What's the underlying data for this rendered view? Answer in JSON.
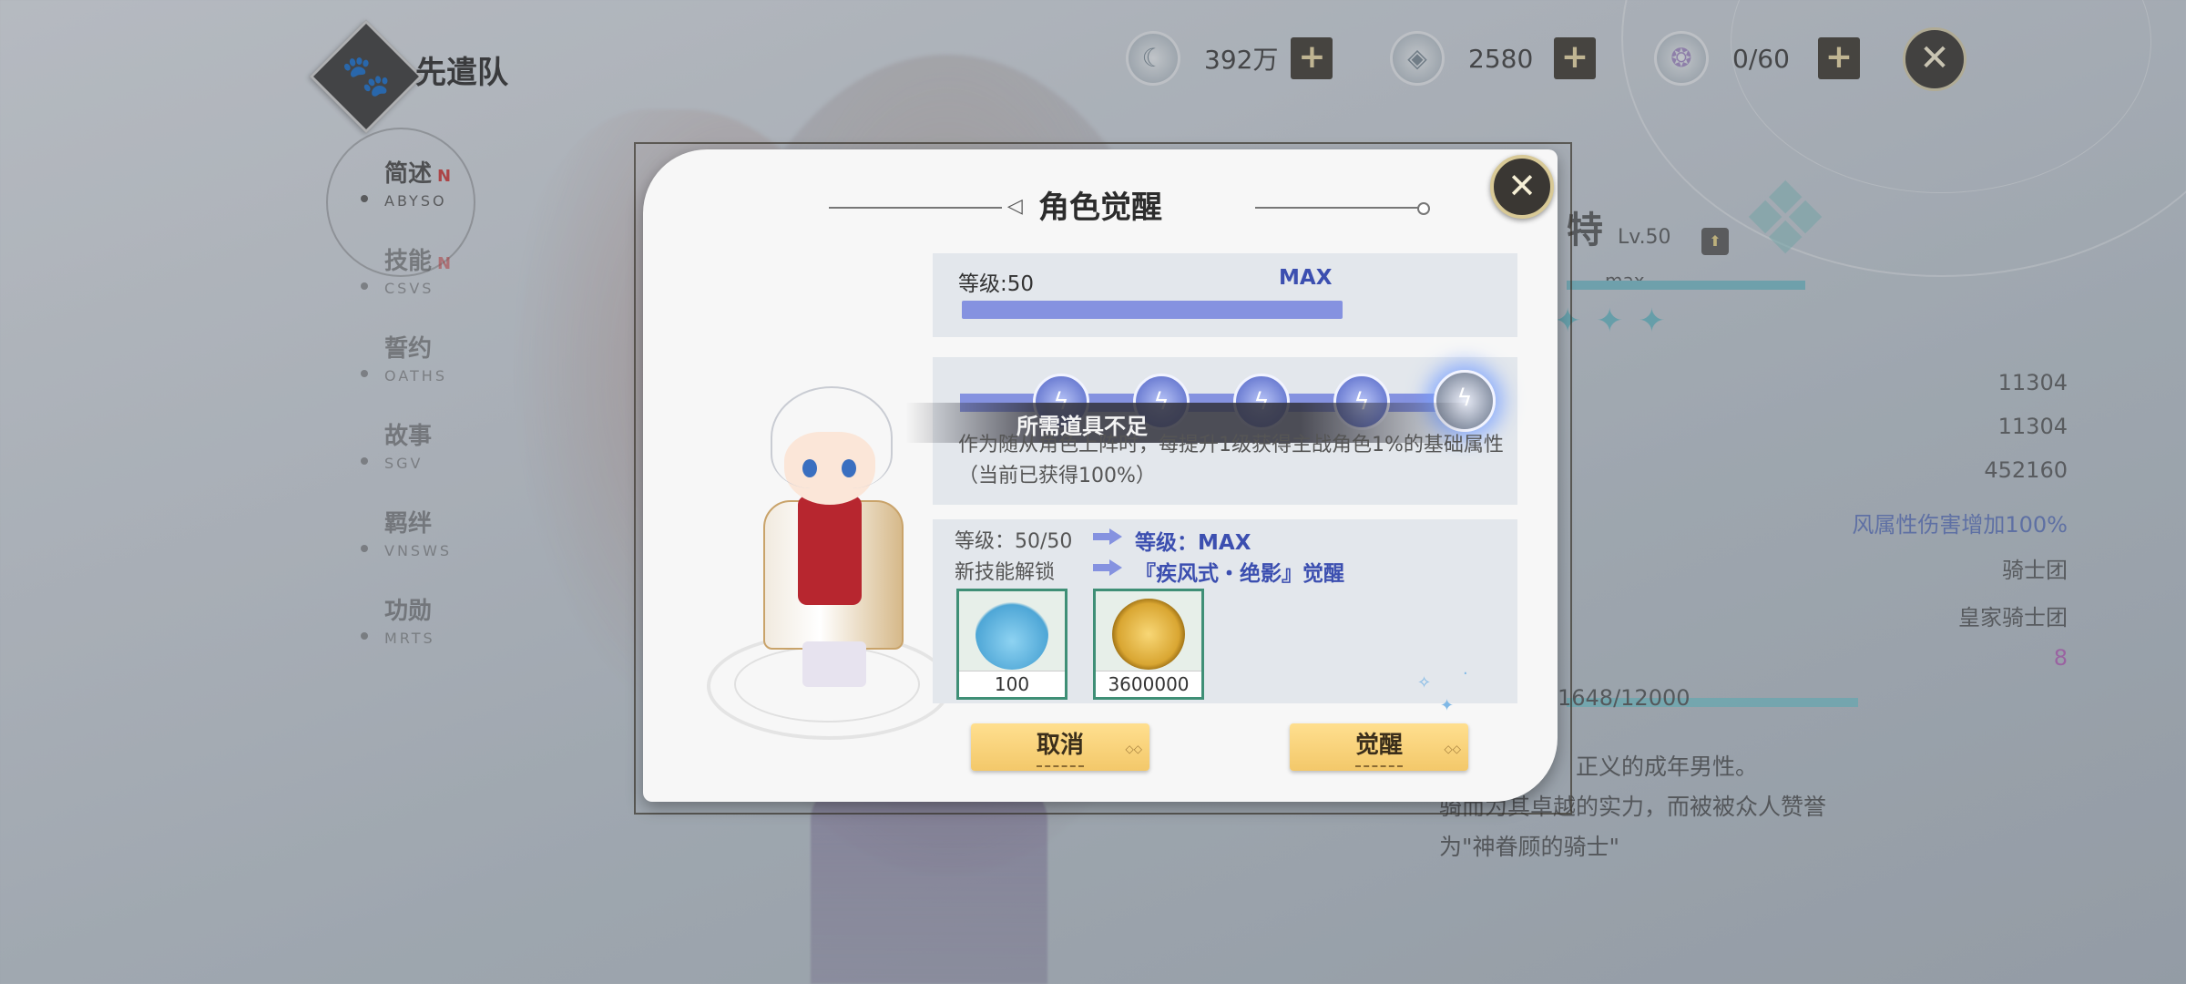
{
  "team": {
    "title": "先遣队",
    "badge_icon": "paw-icon"
  },
  "left_menu": [
    {
      "label": "简述",
      "sub": "ABYSO",
      "new": "N",
      "active": true
    },
    {
      "label": "技能",
      "sub": "CSVS",
      "new": "N",
      "active": false
    },
    {
      "label": "誓约",
      "sub": "OATHS",
      "new": "",
      "active": false
    },
    {
      "label": "故事",
      "sub": "SGV",
      "new": "",
      "active": false
    },
    {
      "label": "羁绊",
      "sub": "VNSWS",
      "new": "",
      "active": false
    },
    {
      "label": "功勋",
      "sub": "MRTS",
      "new": "",
      "active": false
    }
  ],
  "resources": [
    {
      "icon": "moon-coin-icon",
      "value": "392万"
    },
    {
      "icon": "crystal-icon",
      "value": "2580"
    },
    {
      "icon": "stamina-icon",
      "value": "0/60"
    }
  ],
  "right_panel": {
    "name": "特",
    "level": "Lv.50",
    "max_label": "max",
    "stats": [
      "11304",
      "11304",
      "452160"
    ],
    "bonus": "风属性伤害增加100%",
    "attr1": "骑士团",
    "attr2": "皇家骑士团",
    "attr3": "8",
    "exp": "1648/12000",
    "desc_line1": "正义的成年男性。",
    "desc_line2": "骑而为其卓越的实力，而被被众人赞誉",
    "desc_line3": "为\"神眷顾的骑士\""
  },
  "dialog": {
    "title": "角色觉醒",
    "level_label": "等级:50",
    "level_max": "MAX",
    "level_progress": 1.0,
    "banner": "所需道具不足",
    "star_desc": "作为随从角色上阵时，每提升1级获得主战角色1%的基础属性（当前已获得100%）",
    "star_icon": "lightning-icon",
    "upgrade_rows": [
      {
        "from": "等级：50/50",
        "to": "等级：MAX"
      },
      {
        "from": "新技能解锁",
        "to": "『疾风式・绝影』觉醒"
      }
    ],
    "items": [
      {
        "icon": "blue-slime-icon",
        "qty": "100"
      },
      {
        "icon": "gold-coin-icon",
        "qty": "3600000"
      }
    ],
    "cancel_label": "取消",
    "confirm_label": "觉醒"
  },
  "colors": {
    "accent": "#8592e0",
    "button": "#f3c86a",
    "max_text": "#3c4fb0"
  }
}
